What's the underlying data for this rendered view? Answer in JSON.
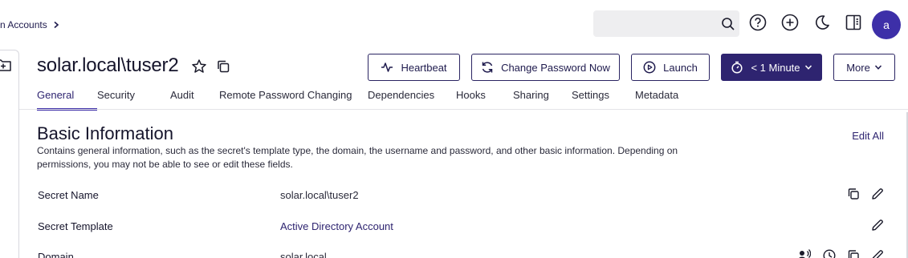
{
  "header": {
    "breadcrumb": "n Accounts",
    "search_placeholder": "",
    "avatar_letter": "a"
  },
  "secret": {
    "title": "solar.local\\tuser2"
  },
  "actions": {
    "heartbeat": "Heartbeat",
    "change_password": "Change Password Now",
    "launch": "Launch",
    "timer": "< 1 Minute",
    "more": "More"
  },
  "tabs": [
    {
      "label": "General",
      "active": true
    },
    {
      "label": "Security"
    },
    {
      "label": "Audit"
    },
    {
      "label": "Remote Password Changing"
    },
    {
      "label": "Dependencies"
    },
    {
      "label": "Hooks"
    },
    {
      "label": "Sharing"
    },
    {
      "label": "Settings"
    },
    {
      "label": "Metadata"
    }
  ],
  "section": {
    "title": "Basic Information",
    "edit_all": "Edit All",
    "description": "Contains general information, such as the secret's template type, the domain, the username and password, and other basic information. Depending on permissions, you may not be able to see or edit these fields."
  },
  "fields": [
    {
      "label": "Secret Name",
      "value": "solar.local\\tuser2"
    },
    {
      "label": "Secret Template",
      "value": "Active Directory Account"
    },
    {
      "label": "Domain",
      "value": "solar.local"
    }
  ],
  "colors": {
    "accent": "#3d2fa8",
    "primary_dark": "#2e2470",
    "search_bg": "#eeeef0"
  }
}
